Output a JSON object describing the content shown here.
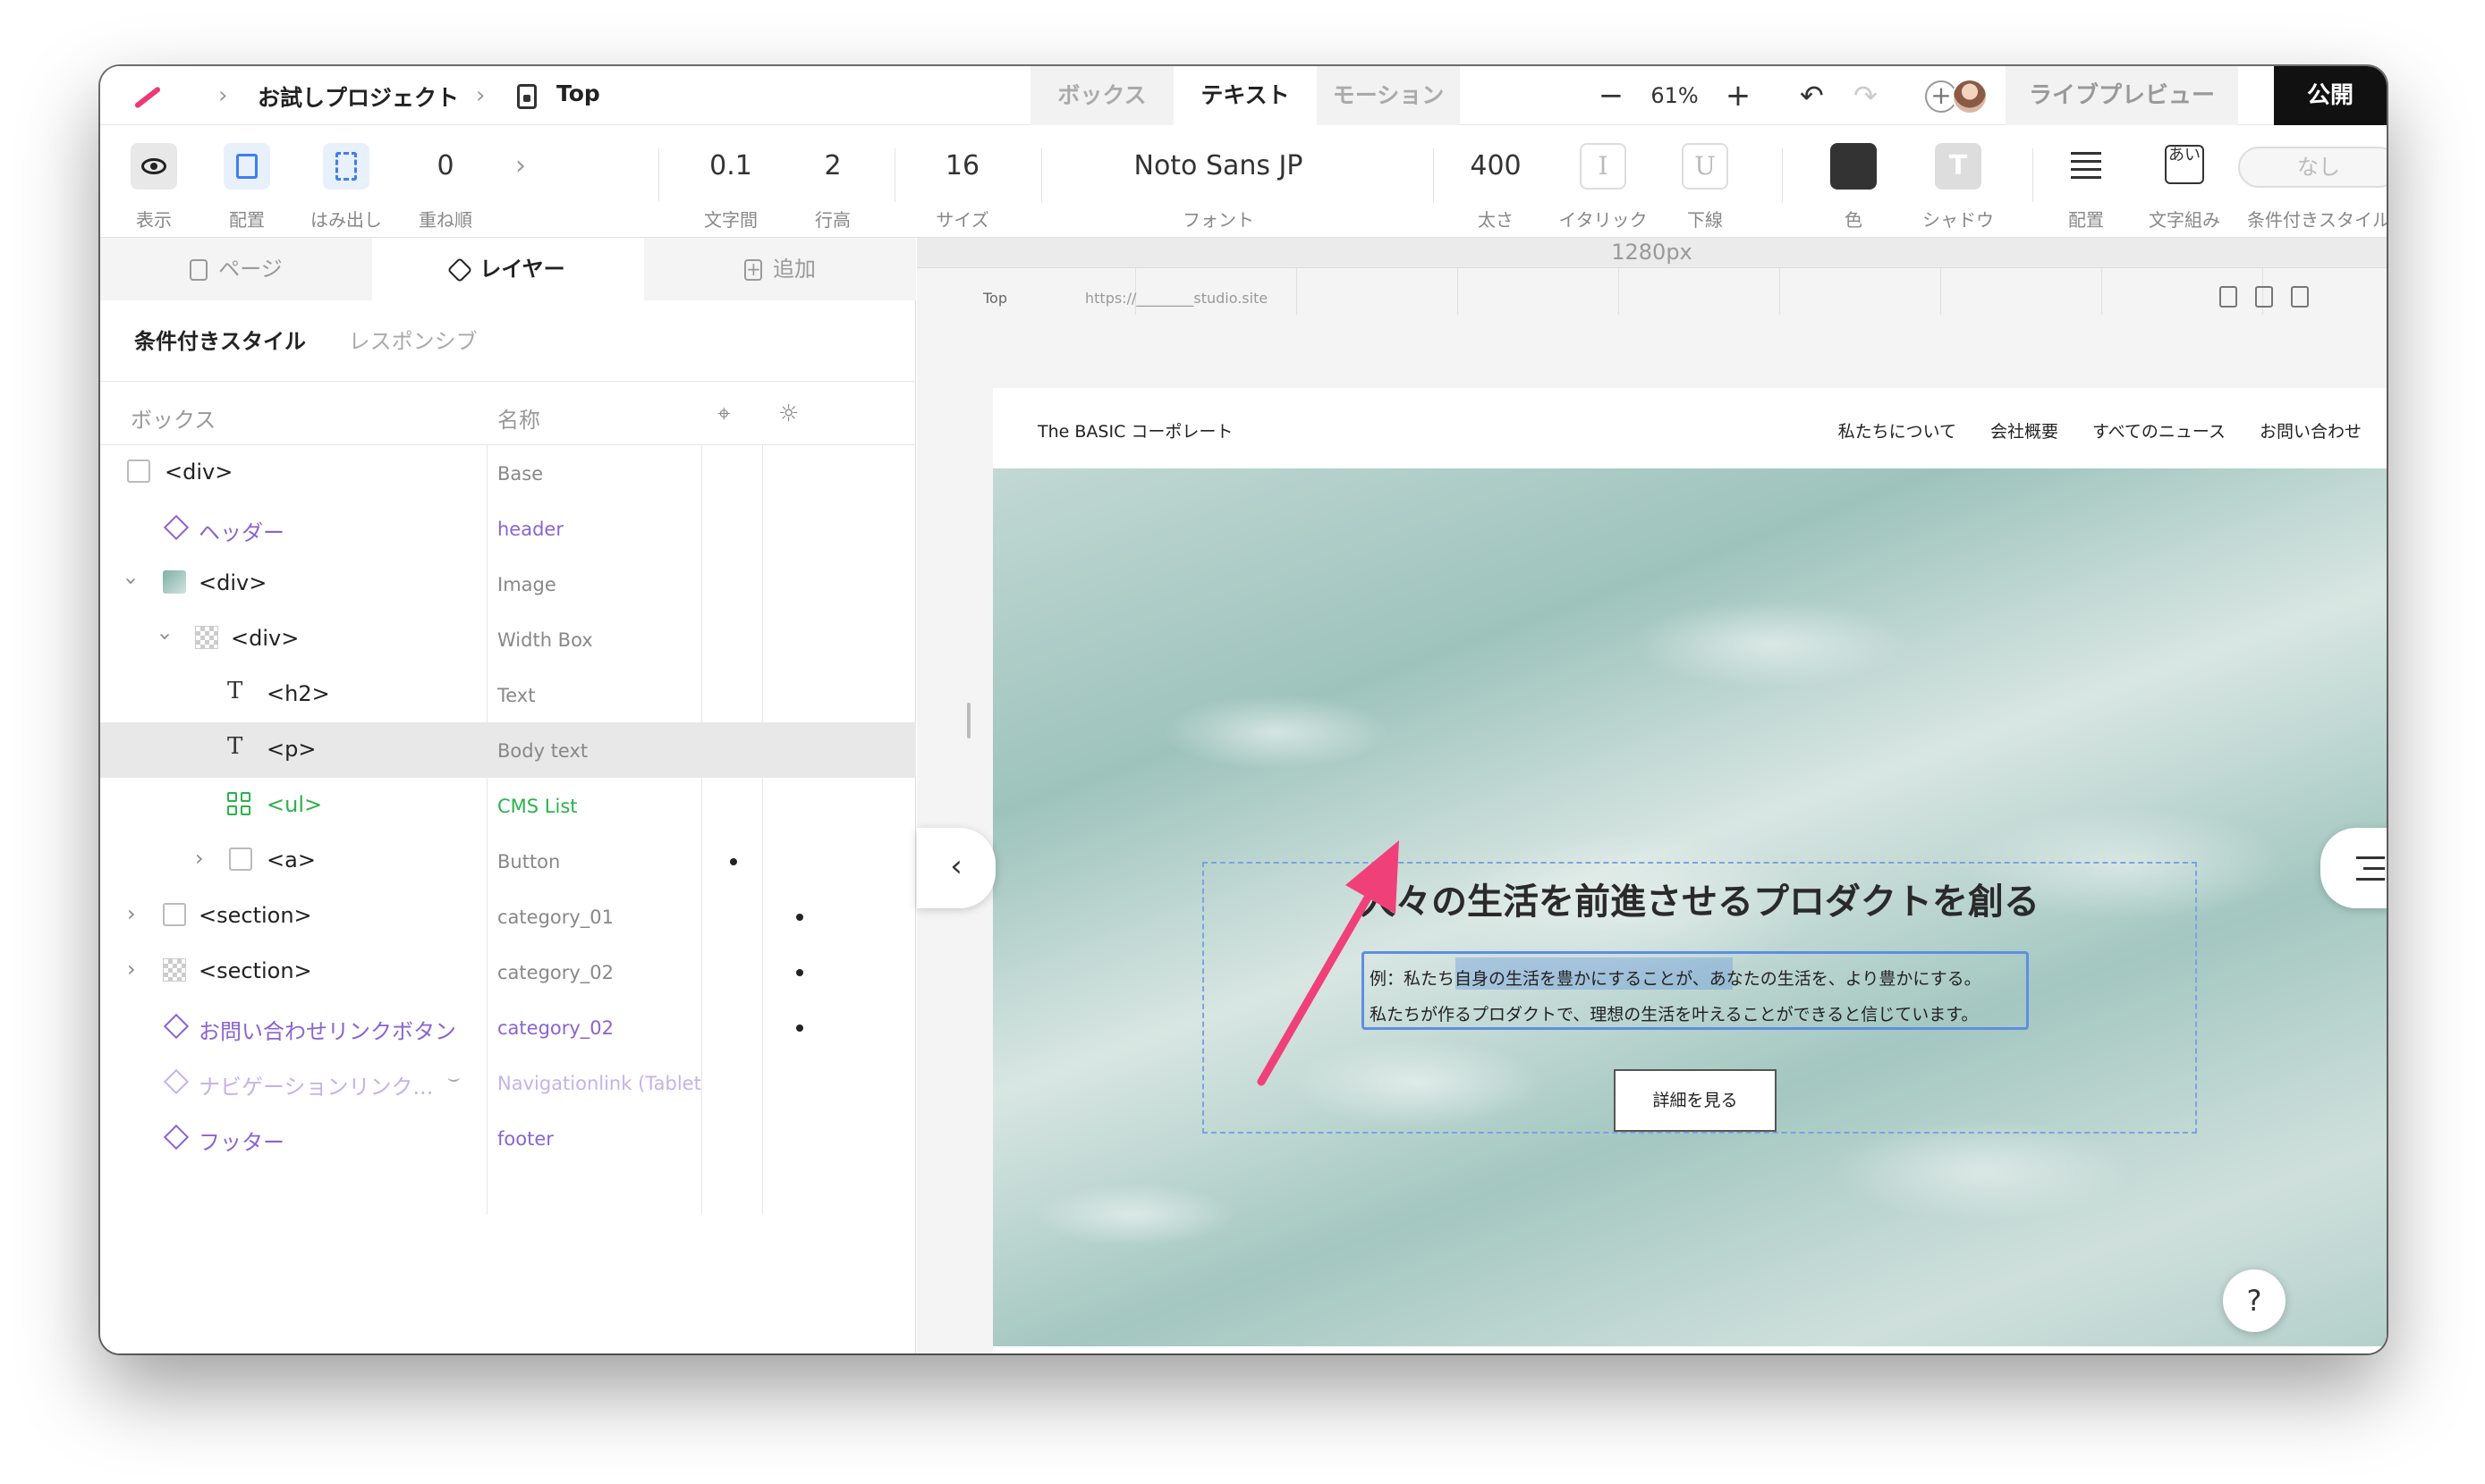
{
  "breadcrumb": {
    "project": "お試しプロジェクト",
    "page": "Top"
  },
  "mode_tabs": [
    "ボックス",
    "テキスト",
    "モーション"
  ],
  "zoom": {
    "minus": "−",
    "value": "61%",
    "plus": "+"
  },
  "header_actions": {
    "preview": "ライブプレビュー",
    "publish": "公開"
  },
  "toolbar": {
    "display_label": "表示",
    "placement_label": "配置",
    "overflow_label": "はみ出し",
    "zorder_value": "0",
    "zorder_label": "重ね順",
    "more": "›",
    "letter_spacing_value": "0.1",
    "letter_spacing_label": "文字間",
    "line_height_value": "2",
    "line_height_label": "行高",
    "size_value": "16",
    "size_label": "サイズ",
    "font_value": "Noto Sans JP",
    "font_label": "フォント",
    "weight_value": "400",
    "weight_label": "太さ",
    "italic_glyph": "I",
    "italic_label": "イタリック",
    "underline_glyph": "U",
    "underline_label": "下線",
    "color_label": "色",
    "color_value": "#333333",
    "shadow_glyph": "T",
    "shadow_label": "シャドウ",
    "align_label": "配置",
    "wrap_glyph": "あい",
    "wrap_label": "文字組み",
    "cond_value": "なし",
    "cond_label": "条件付きスタイル"
  },
  "panel": {
    "tabs": [
      "ページ",
      "レイヤー",
      "追加"
    ],
    "subtabs": {
      "conditional": "条件付きスタイル",
      "responsive": "レスポンシブ"
    },
    "columns": {
      "box": "ボックス",
      "name": "名称"
    },
    "rows": [
      {
        "tag": "<div>",
        "name": "Base"
      },
      {
        "tag": "ヘッダー",
        "name": "header"
      },
      {
        "tag": "<div>",
        "name": "Image"
      },
      {
        "tag": "<div>",
        "name": "Width Box"
      },
      {
        "tag": "<h2>",
        "name": "Text"
      },
      {
        "tag": "<p>",
        "name": "Body text"
      },
      {
        "tag": "<ul>",
        "name": "CMS List"
      },
      {
        "tag": "<a>",
        "name": "Button"
      },
      {
        "tag": "<section>",
        "name": "category_01"
      },
      {
        "tag": "<section>",
        "name": "category_02"
      },
      {
        "tag": "お問い合わせリンクボタン",
        "name": "category_02"
      },
      {
        "tag": "ナビゲーションリンク...",
        "name": "Navigationlink (Tablet"
      },
      {
        "tag": "フッター",
        "name": "footer"
      }
    ]
  },
  "canvas": {
    "ruler_label": "1280px",
    "frame_page": "Top",
    "frame_url": "https://________studio.site"
  },
  "site": {
    "logo": "The BASIC コーポレート",
    "nav": [
      "私たちについて",
      "会社概要",
      "すべてのニュース",
      "お問い合わせ"
    ],
    "hero_title": "人々の生活を前進させるプロダクトを創る",
    "hero_body_line1": "例：私たち自身の生活を豊かにすることが、あなたの生活を、より豊かにする。",
    "hero_body_line2": "私たちが作るプロダクトで、理想の生活を叶えることができると信じています。",
    "button": "詳細を見る"
  },
  "help": "?",
  "colors": {
    "accent": "#ec3a74",
    "selection": "#5d8fe0",
    "component": "#8a63d2",
    "cms": "#2bb24c"
  }
}
